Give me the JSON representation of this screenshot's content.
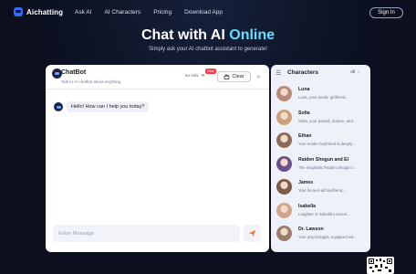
{
  "nav": {
    "brand": "Aichatting",
    "links": [
      "Ask AI",
      "AI Characters",
      "Pricing",
      "Download App"
    ],
    "signin": "Sign In"
  },
  "hero": {
    "title_part1": "Chat with AI",
    "title_part2": "Online",
    "subtitle": "Simply ask your AI chatbot assistant to generate!"
  },
  "chat": {
    "title": "ChatBot",
    "subtitle": "Talk to AI chatbot about anything",
    "model": "4o mini",
    "badge": "New",
    "clear_label": "Clear",
    "messages": [
      {
        "sender": "bot",
        "text": "Hello! How can I help you today?"
      }
    ],
    "input_placeholder": "Enter Message"
  },
  "characters": {
    "title": "Characters",
    "all_label": "All",
    "items": [
      {
        "name": "Luna",
        "desc": "Luna, your tender girlfriend,..",
        "color": "#b98a7a"
      },
      {
        "name": "Sofia",
        "desc": "Sofia, your poised, mature, and...",
        "color": "#c9a27c"
      },
      {
        "name": "Ethan",
        "desc": "Your tender boyfriend is deeply...",
        "color": "#8c6a5a"
      },
      {
        "name": "Raiden Shogun and Ei",
        "desc": "The enigmatic Raiden Shogun i...",
        "color": "#6d4f8f"
      },
      {
        "name": "James",
        "desc": "Your know-it-all boyfriend,...",
        "color": "#7d5c48"
      },
      {
        "name": "Isabella",
        "desc": "Laughter is Isabella's secret...",
        "color": "#d0a58c"
      },
      {
        "name": "Dr. Lawson",
        "desc": "Your psychologist, equipped wit...",
        "color": "#9c7c6c"
      }
    ]
  }
}
